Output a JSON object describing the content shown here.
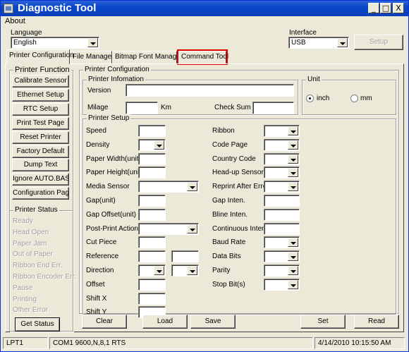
{
  "window": {
    "title": "Diagnostic Tool"
  },
  "window_buttons": {
    "minimize": "_",
    "maximize": "□",
    "close": "X"
  },
  "menu": {
    "about": "About"
  },
  "language": {
    "label": "Language",
    "value": "English"
  },
  "interface": {
    "label": "Interface",
    "value": "USB",
    "setup": "Setup"
  },
  "tabs": [
    "Printer Configuration",
    "File Manager",
    "Bitmap Font Manager",
    "Command Tool"
  ],
  "printer_function": {
    "title": "Printer Function",
    "buttons": [
      "Calibrate Sensor",
      "Ethernet Setup",
      "RTC Setup",
      "Print Test Page",
      "Reset Printer",
      "Factory Default",
      "Dump Text",
      "Ignore AUTO.BAS",
      "Configuration Page"
    ]
  },
  "printer_status": {
    "title": "Printer Status",
    "items": [
      "Ready",
      "Head Open",
      "Paper Jam",
      "Out of Paper",
      "Ribbon End Err.",
      "Ribbon Encoder Err.",
      "Pause",
      "Printing",
      "Other Error"
    ],
    "get_status": "Get Status"
  },
  "printer_configuration": {
    "title": "Printer Configuration"
  },
  "printer_information": {
    "title": "Printer Infomation",
    "version": "Version",
    "milage": "Milage",
    "km": "Km",
    "check_sum": "Check Sum"
  },
  "unit": {
    "title": "Unit",
    "inch": "inch",
    "mm": "mm",
    "selected": "inch"
  },
  "printer_setup": {
    "title": "Printer Setup",
    "left": [
      "Speed",
      "Density",
      "Paper Width(unit)",
      "Paper Height(unit)",
      "Media Sensor",
      "Gap(unit)",
      "Gap Offset(unit)",
      "Post-Print Action",
      "Cut Piece",
      "Reference",
      "Direction",
      "Offset",
      "Shift X",
      "Shift Y"
    ],
    "right": [
      "Ribbon",
      "Code Page",
      "Country Code",
      "Head-up Sensor",
      "Reprint After Error",
      "Gap Inten.",
      "Bline Inten.",
      "Continuous Inten.",
      "Baud Rate",
      "Data Bits",
      "Parity",
      "Stop Bit(s)"
    ]
  },
  "actions": {
    "clear": "Clear",
    "load": "Load",
    "save": "Save",
    "set": "Set",
    "read": "Read"
  },
  "statusbar": {
    "port": "LPT1",
    "com": "COM1 9600,N,8,1 RTS",
    "datetime": "4/14/2010 10:15:50 AM"
  },
  "colors": {
    "title_bar": "#0a46c9",
    "highlight": "#e00000",
    "face": "#ece9d8"
  }
}
